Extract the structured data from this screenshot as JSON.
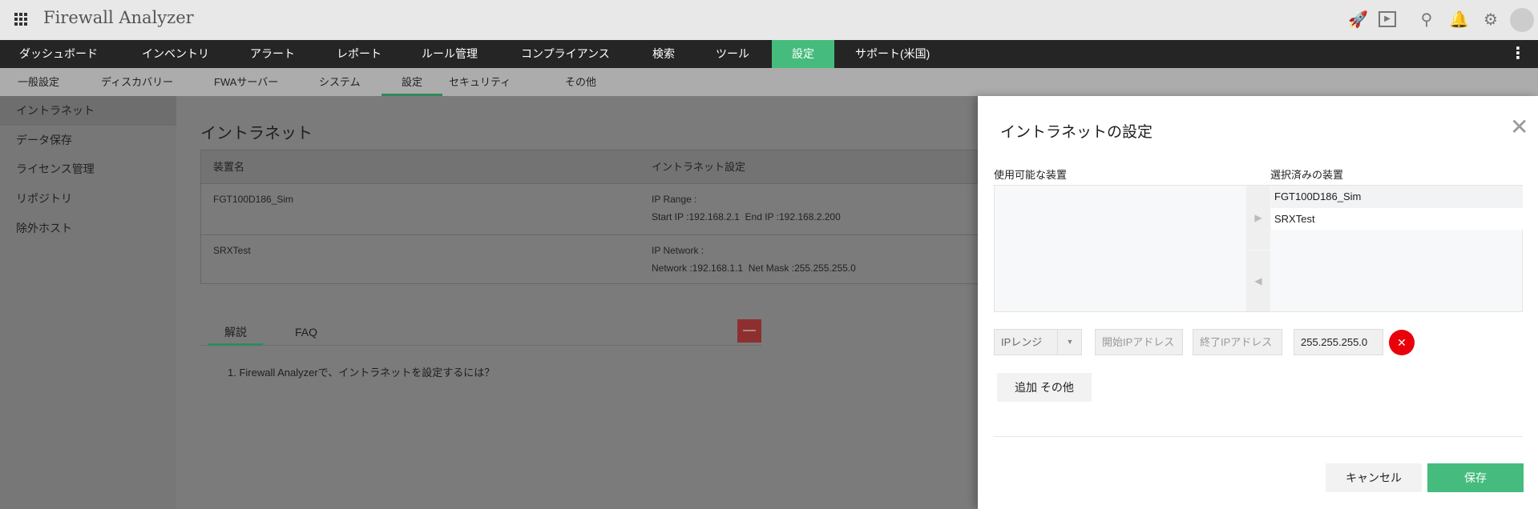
{
  "header": {
    "title": "Firewall Analyzer",
    "icons": [
      "apps-grid-icon",
      "rocket-icon",
      "presentation-icon",
      "search-icon",
      "bell-icon",
      "gear-icon",
      "user-avatar-icon"
    ]
  },
  "topnav": [
    {
      "label": "ダッシュボード"
    },
    {
      "label": "インベントリ"
    },
    {
      "label": "アラート"
    },
    {
      "label": "レポート"
    },
    {
      "label": "ルール管理"
    },
    {
      "label": "コンプライアンス"
    },
    {
      "label": "検索"
    },
    {
      "label": "ツール"
    },
    {
      "label": "設定",
      "active": true
    },
    {
      "label": "サポート(米国)"
    }
  ],
  "subnav": [
    {
      "label": "一般設定"
    },
    {
      "label": "ディスカバリー"
    },
    {
      "label": "FWAサーバー"
    },
    {
      "label": "システム"
    },
    {
      "label": "設定",
      "active": true
    },
    {
      "label": "セキュリティ"
    },
    {
      "label": "その他"
    }
  ],
  "sidebar": [
    {
      "label": "イントラネット",
      "active": true
    },
    {
      "label": "データ保存"
    },
    {
      "label": "ライセンス管理"
    },
    {
      "label": "リポジトリ"
    },
    {
      "label": "除外ホスト"
    }
  ],
  "page": {
    "title": "イントラネット",
    "table": {
      "headers": [
        "装置名",
        "イントラネット設定"
      ],
      "rows": [
        {
          "device": "FGT100D186_Sim",
          "line1": "IP Range :",
          "line2": "Start IP :192.168.2.1  End IP :192.168.2.200"
        },
        {
          "device": "SRXTest",
          "line1": "IP Network :",
          "line2": "Network :192.168.1.1  Net Mask :255.255.255.0"
        }
      ]
    },
    "help_tabs": [
      "解説",
      "FAQ"
    ],
    "faq_question": "1. Firewall Analyzerで、イントラネットを設定するには？"
  },
  "modal": {
    "title": "イントラネットの設定",
    "available_label": "使用可能な装置",
    "selected_label": "選択済みの装置",
    "selected_devices": [
      "FGT100D186_Sim",
      "SRXTest"
    ],
    "type_select": "IPレンジ",
    "start_placeholder": "開始IPアドレス",
    "end_placeholder": "終了IPアドレス",
    "mask_value": "255.255.255.0",
    "add_more": "追加 その他",
    "cancel": "キャンセル",
    "save": "保存"
  },
  "colors": {
    "accent": "#45bc7d",
    "danger": "#e8000b"
  }
}
